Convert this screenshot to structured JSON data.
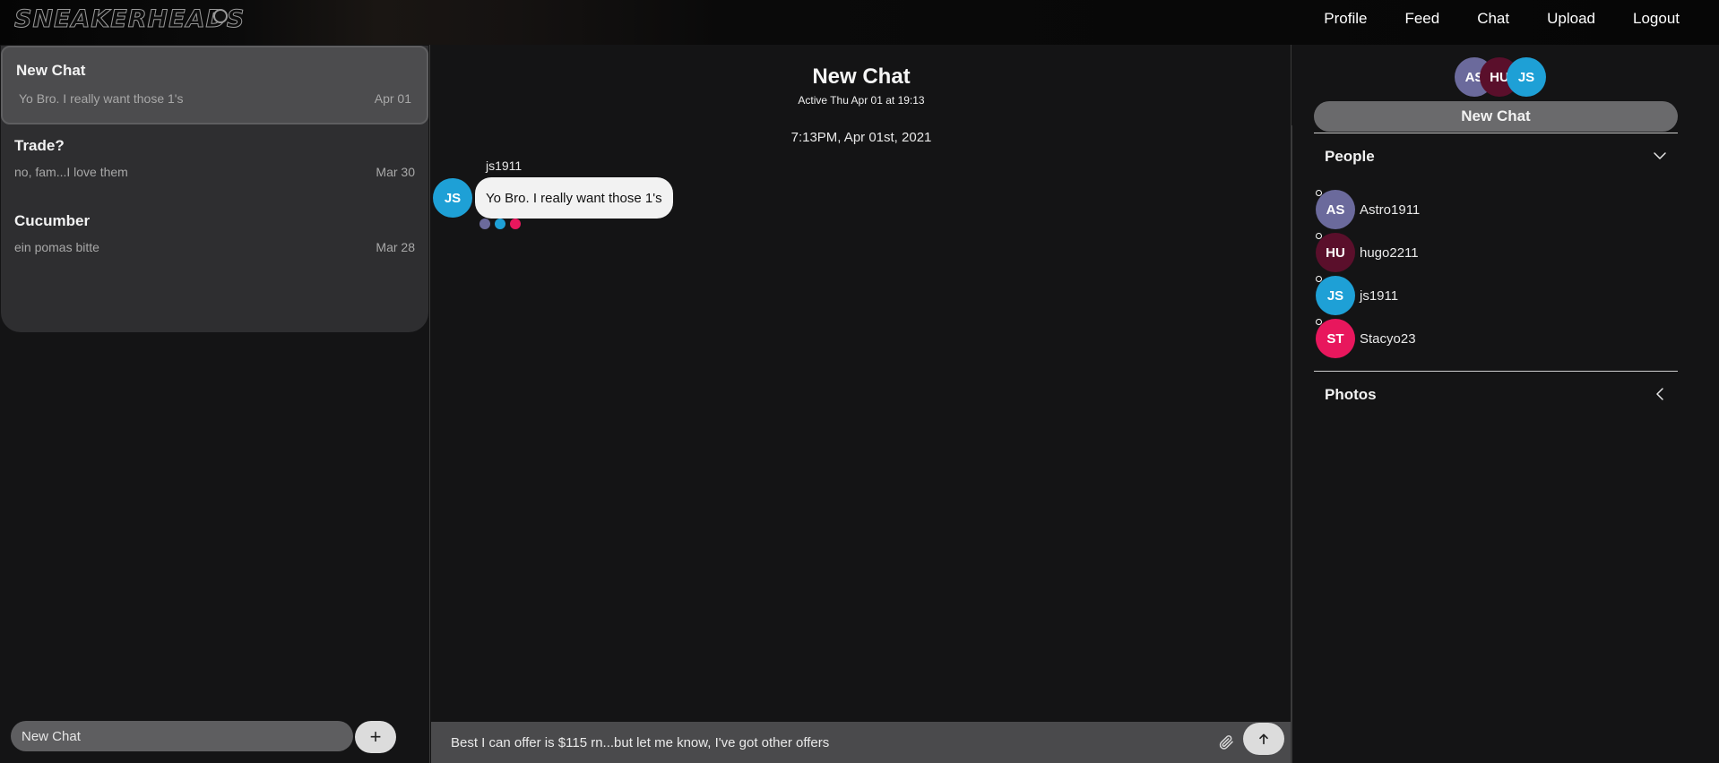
{
  "brand": {
    "logo_text": "SNEAKERHEADS"
  },
  "nav": {
    "items": [
      {
        "label": "Profile"
      },
      {
        "label": "Feed"
      },
      {
        "label": "Chat"
      },
      {
        "label": "Upload"
      },
      {
        "label": "Logout"
      }
    ]
  },
  "conversations": [
    {
      "title": "New Chat",
      "preview": "Yo Bro. I really want those 1's",
      "date": "Apr 01",
      "active": true
    },
    {
      "title": "Trade?",
      "preview": "no, fam...I love them",
      "date": "Mar 30",
      "active": false
    },
    {
      "title": "Cucumber",
      "preview": "ein pomas bitte",
      "date": "Mar 28",
      "active": false
    }
  ],
  "left_footer": {
    "new_chat_value": "New Chat",
    "add_label": "+"
  },
  "chat": {
    "title": "New Chat",
    "subtitle": "Active Thu Apr 01 at 19:13",
    "timestamp": "7:13PM, Apr 01st, 2021",
    "messages": [
      {
        "sender": "js1911",
        "avatar_initials": "JS",
        "avatar_color": "#1ea0d6",
        "text": "Yo Bro. I really want those 1's",
        "read_by_colors": [
          "#6b6a9c",
          "#1ea0d6",
          "#e8175d"
        ]
      }
    ],
    "composer_value": "Best I can offer is $115 rn...but let me know, I've got other offers",
    "attach_icon": "paperclip-icon",
    "send_icon": "arrow-up-icon"
  },
  "right_panel": {
    "group_avatars": [
      {
        "initials": "AS",
        "color": "#6b6a9c"
      },
      {
        "initials": "HU",
        "color": "#5a0f2b"
      },
      {
        "initials": "JS",
        "color": "#1ea0d6"
      }
    ],
    "new_chat_button": "New Chat",
    "people_section": {
      "title": "People",
      "expanded": true,
      "people": [
        {
          "initials": "AS",
          "name": "Astro1911",
          "color": "#6b6a9c"
        },
        {
          "initials": "HU",
          "name": "hugo2211",
          "color": "#5a0f2b"
        },
        {
          "initials": "JS",
          "name": "js1911",
          "color": "#1ea0d6"
        },
        {
          "initials": "ST",
          "name": "Stacyo23",
          "color": "#e8175d"
        }
      ]
    },
    "photos_section": {
      "title": "Photos",
      "expanded": false
    }
  }
}
